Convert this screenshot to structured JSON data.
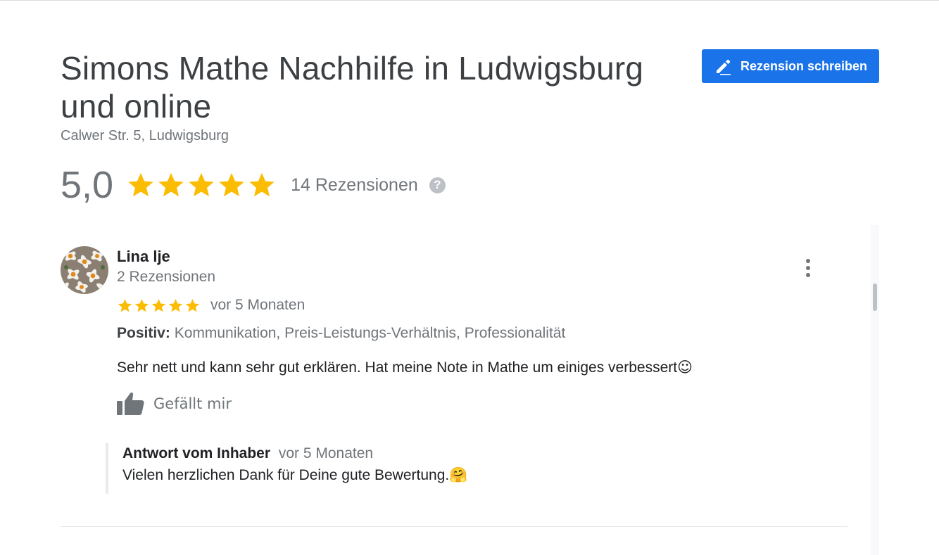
{
  "business": {
    "name": "Simons Mathe Nachhilfe in Ludwigsburg und online",
    "address": "Calwer Str. 5, Ludwigsburg"
  },
  "actions": {
    "write_review_label": "Rezension schreiben"
  },
  "summary": {
    "rating": "5,0",
    "stars": 5,
    "review_count_label": "14 Rezensionen",
    "help_icon": "?"
  },
  "review": {
    "author": "Lina lje",
    "author_reviews": "2 Rezensionen",
    "stars": 5,
    "time": "vor 5 Monaten",
    "positive_label": "Positiv:",
    "positive_items": "Kommunikation, Preis-Leistungs-Verhältnis, Professionalität",
    "text": "Sehr nett und kann sehr gut erklären. Hat meine Note in Mathe um einiges verbessert",
    "text_emoji": "☺",
    "like_label": "Gefällt mir",
    "reply": {
      "author": "Antwort vom Inhaber",
      "time": "vor 5 Monaten",
      "text": "Vielen herzlichen Dank für Deine gute Bewertung.",
      "emoji": "🤗"
    }
  },
  "colors": {
    "accent": "#1a73e8",
    "star": "#fbbc04",
    "muted_text": "#70757a"
  }
}
